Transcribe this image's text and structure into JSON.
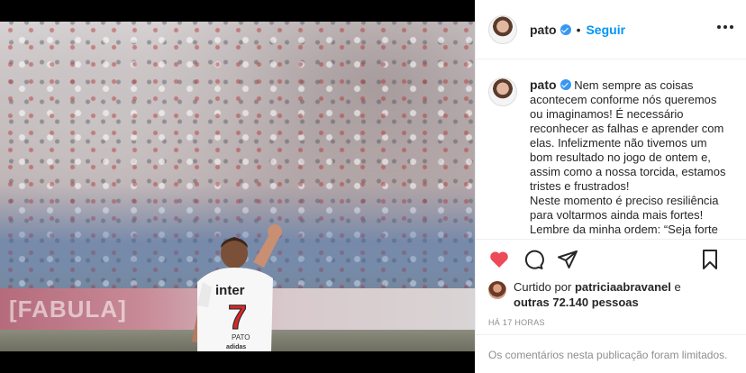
{
  "post": {
    "author": {
      "username": "pato",
      "verified": true,
      "follow_label": "Seguir",
      "separator": "•"
    },
    "image": {
      "jersey_sponsor": "inter",
      "jersey_number": "7",
      "jersey_name": "PATO",
      "ad_board_text": "[FABULA]",
      "jersey_brand": "adidas"
    },
    "caption": {
      "username": "pato",
      "lines": [
        "Nem sempre as coisas",
        "acontecem conforme nós queremos",
        "ou imaginamos! É necessário",
        "reconhecer as falhas e aprender com",
        "elas. Infelizmente não tivemos um",
        "bom resultado no jogo de ontem e,",
        "assim como a nossa torcida, estamos",
        "tristes e frustrados!",
        "Neste momento é preciso resiliência",
        "para voltarmos ainda mais fortes!",
        "Lembre da minha ordem: “Seja forte"
      ]
    },
    "actions": {
      "like_icon": "heart-filled-icon",
      "comment_icon": "comment-icon",
      "share_icon": "share-icon",
      "save_icon": "bookmark-icon",
      "like_color": "#ed4956"
    },
    "likes": {
      "prefix": "Curtido por",
      "liked_by": "patriciaabravanel",
      "suffix": "e",
      "others_label": "outras 72.140 pessoas"
    },
    "timestamp": "HÁ 17 HORAS",
    "comments_notice": "Os comentários nesta publicação foram limitados."
  }
}
